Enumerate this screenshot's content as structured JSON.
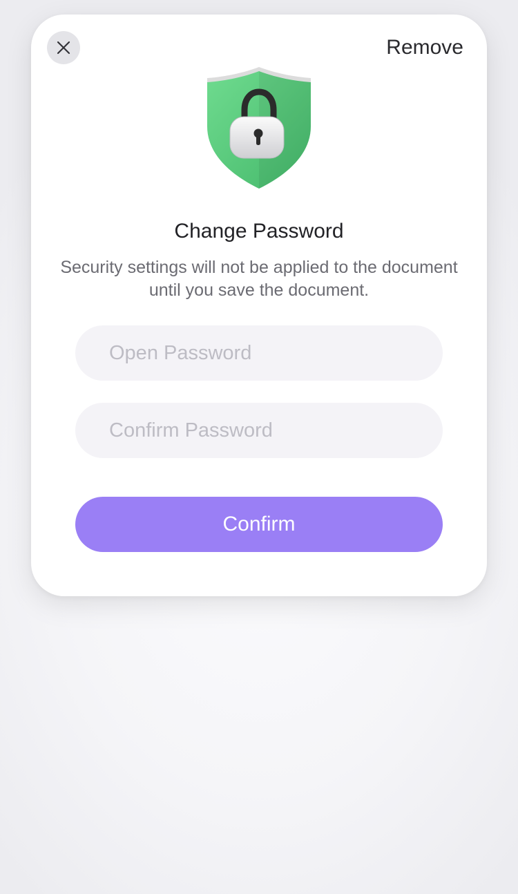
{
  "dialog": {
    "remove_label": "Remove",
    "title": "Change Password",
    "description": "Security settings will not be applied to the document until you save the document.",
    "open_password_placeholder": "Open Password",
    "open_password_value": "",
    "confirm_password_placeholder": "Confirm Password",
    "confirm_password_value": "",
    "confirm_label": "Confirm"
  },
  "icons": {
    "close": "close-icon",
    "shield": "shield-lock-icon"
  },
  "colors": {
    "accent": "#9a7ff5",
    "shield_green": "#5fcf80",
    "field_bg": "#f4f3f7"
  }
}
